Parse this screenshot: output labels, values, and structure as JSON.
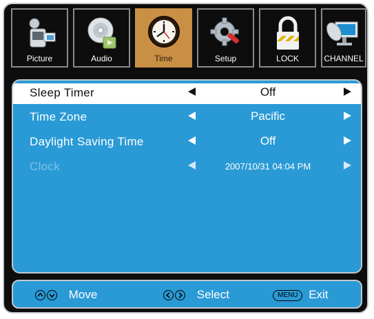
{
  "tabs": [
    {
      "label": "Picture",
      "icon": "camcorder-icon",
      "active": false
    },
    {
      "label": "Audio",
      "icon": "audio-disc-icon",
      "active": false
    },
    {
      "label": "Time",
      "icon": "clock-icon",
      "active": true
    },
    {
      "label": "Setup",
      "icon": "gear-wrench-icon",
      "active": false
    },
    {
      "label": "LOCK",
      "icon": "padlock-icon",
      "active": false
    },
    {
      "label": "CHANNEL",
      "icon": "satellite-dish-icon",
      "active": false
    }
  ],
  "menu": {
    "items": [
      {
        "label": "Sleep Timer",
        "value": "Off",
        "selected": true
      },
      {
        "label": "Time Zone",
        "value": "Pacific",
        "selected": false
      },
      {
        "label": "Daylight Saving Time",
        "value": "Off",
        "selected": false
      },
      {
        "label": "Clock",
        "value": "2007/10/31 04:04 PM",
        "selected": false,
        "disabled": true
      }
    ]
  },
  "help": {
    "move": "Move",
    "select": "Select",
    "menu_key": "MENU",
    "exit": "Exit"
  },
  "colors": {
    "frame": "#0d0d0d",
    "panel": "#2a9ad6",
    "active_tab": "#c98f45",
    "selected_row": "#ffffff"
  }
}
